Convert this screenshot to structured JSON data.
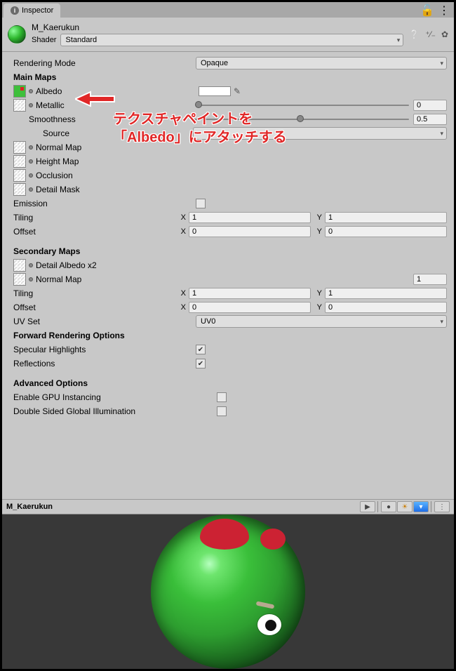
{
  "tab": {
    "title": "Inspector"
  },
  "header": {
    "material_name": "M_Kaerukun",
    "shader_label": "Shader",
    "shader_value": "Standard"
  },
  "rendering_mode": {
    "label": "Rendering Mode",
    "value": "Opaque"
  },
  "main_maps": {
    "heading": "Main Maps",
    "albedo": {
      "label": "Albedo"
    },
    "metallic": {
      "label": "Metallic",
      "value": "0",
      "slider": 0
    },
    "smoothness": {
      "label": "Smoothness",
      "value": "0.5",
      "slider": 50
    },
    "source": {
      "label": "Source",
      "value": ""
    },
    "normal": {
      "label": "Normal Map"
    },
    "height": {
      "label": "Height Map"
    },
    "occlusion": {
      "label": "Occlusion"
    },
    "detail_mask": {
      "label": "Detail Mask"
    },
    "emission": {
      "label": "Emission"
    },
    "tiling": {
      "label": "Tiling",
      "x": "1",
      "y": "1"
    },
    "offset": {
      "label": "Offset",
      "x": "0",
      "y": "0"
    }
  },
  "secondary_maps": {
    "heading": "Secondary Maps",
    "detail_albedo": {
      "label": "Detail Albedo x2"
    },
    "normal": {
      "label": "Normal Map",
      "value": "1"
    },
    "tiling": {
      "label": "Tiling",
      "x": "1",
      "y": "1"
    },
    "offset": {
      "label": "Offset",
      "x": "0",
      "y": "0"
    },
    "uv_set": {
      "label": "UV Set",
      "value": "UV0"
    }
  },
  "forward": {
    "heading": "Forward Rendering Options",
    "spec": {
      "label": "Specular Highlights",
      "on": true
    },
    "refl": {
      "label": "Reflections",
      "on": true
    }
  },
  "advanced": {
    "heading": "Advanced Options",
    "gpu": {
      "label": "Enable GPU Instancing",
      "on": false
    },
    "dsgi": {
      "label": "Double Sided Global Illumination",
      "on": false
    }
  },
  "preview": {
    "name": "M_Kaerukun"
  },
  "annotation": {
    "line1": "テクスチャペイントを",
    "line2": "「Albedo」にアタッチする"
  },
  "labels": {
    "x": "X",
    "y": "Y"
  }
}
